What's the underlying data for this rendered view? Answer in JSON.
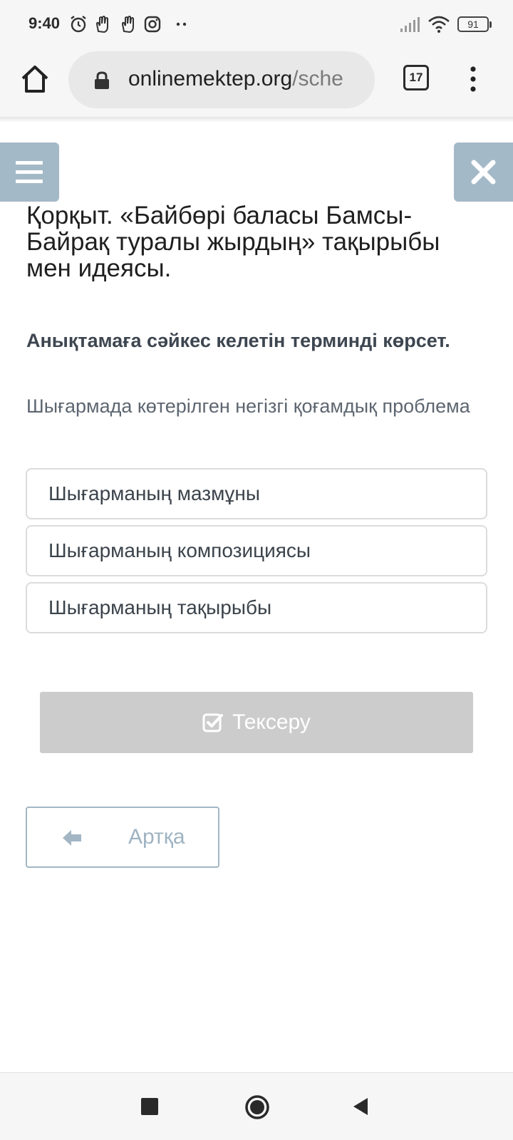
{
  "status_bar": {
    "time": "9:40",
    "battery": "91",
    "icons": [
      "alarm-icon",
      "hand-icon",
      "hand-icon",
      "instagram-icon",
      "more-dots-icon",
      "signal-icon",
      "wifi-icon",
      "battery-icon"
    ]
  },
  "browser": {
    "url_domain": "onlinemektep.org",
    "url_path": "/sche",
    "tab_count": "17"
  },
  "lesson": {
    "title": "Қорқыт. «Байбөрі баласы Бамсы-Байрақ туралы жырдың» тақырыбы мен идеясы."
  },
  "question": {
    "prompt": "Анықтамаға сәйкес келетін терминді көрсет.",
    "definition": "Шығармада көтерілген негізгі қоғамдық проблема",
    "options": [
      "Шығарманың мазмұны",
      "Шығарманың композициясы",
      "Шығарманың тақырыбы"
    ]
  },
  "buttons": {
    "check_label": "Тексеру",
    "back_label": "Артқа"
  },
  "colors": {
    "accent": "#a4b9c7",
    "check_disabled": "#cccccc",
    "back_text": "#9fb3c1"
  }
}
